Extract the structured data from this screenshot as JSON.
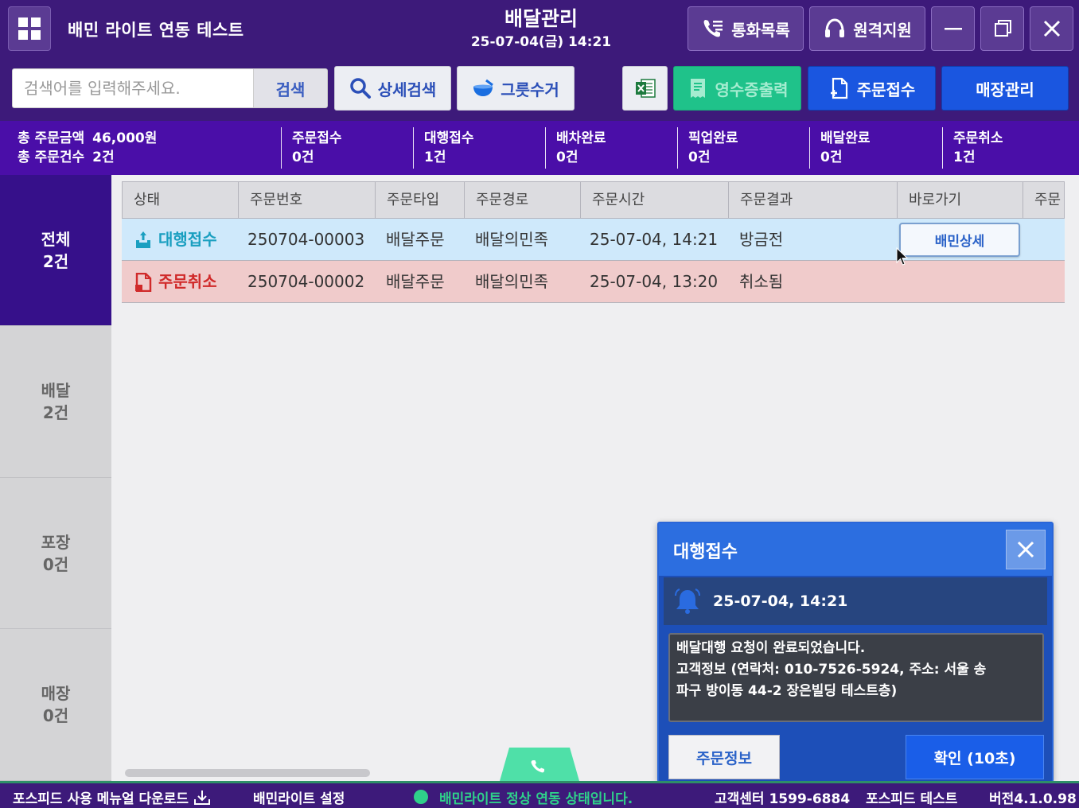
{
  "titlebar": {
    "app_title": "배민 라이트 연동 테스트",
    "page_title": "배달관리",
    "datetime": "25-07-04(금) 14:21",
    "call_log_label": "통화목록",
    "remote_support_label": "원격지원"
  },
  "toolbar": {
    "search_placeholder": "검색어를 입력해주세요.",
    "search_label": "검색",
    "detail_search_label": "상세검색",
    "group_collect_label": "그릇수거",
    "receipt_print_label": "영수증출력",
    "order_receive_label": "주문접수",
    "store_manage_label": "매장관리"
  },
  "stats": {
    "total_amount_label": "총 주문금액",
    "total_amount_value": "46,000원",
    "total_count_label": "총 주문건수",
    "total_count_value": "2건",
    "items": [
      {
        "label": "주문접수",
        "value": "0건"
      },
      {
        "label": "대행접수",
        "value": "1건"
      },
      {
        "label": "배차완료",
        "value": "0건"
      },
      {
        "label": "픽업완료",
        "value": "0건"
      },
      {
        "label": "배달완료",
        "value": "0건"
      },
      {
        "label": "주문취소",
        "value": "1건"
      }
    ]
  },
  "leftnav": [
    {
      "label": "전체",
      "count": "2건"
    },
    {
      "label": "배달",
      "count": "2건"
    },
    {
      "label": "포장",
      "count": "0건"
    },
    {
      "label": "매장",
      "count": "0건"
    }
  ],
  "table": {
    "headers": [
      "상태",
      "주문번호",
      "주문타입",
      "주문경로",
      "주문시간",
      "주문결과",
      "바로가기",
      "주문"
    ],
    "rows": [
      {
        "status": "대행접수",
        "order_no": "250704-00003",
        "type": "배달주문",
        "route": "배달의민족",
        "time": "25-07-04, 14:21",
        "result": "방금전",
        "shortcut": "배민상세"
      },
      {
        "status": "주문취소",
        "order_no": "250704-00002",
        "type": "배달주문",
        "route": "배달의민족",
        "time": "25-07-04, 13:20",
        "result": "취소됨",
        "shortcut": ""
      }
    ]
  },
  "popup": {
    "title": "대행접수",
    "datetime": "25-07-04, 14:21",
    "message_line1": "배달대행 요청이 완료되었습니다.",
    "message_line2": "고객정보 (연락처: 010-7526-5924, 주소: 서울 송",
    "message_line3": "파구 방이동 44-2 장은빌딩 테스트층)",
    "order_info_label": "주문정보",
    "confirm_label": "확인 (10초)"
  },
  "statusbar": {
    "manual_label": "포스피드 사용 메뉴얼 다운로드",
    "settings_label": "배민라이트 설정",
    "status_text": "배민라이트 정상 연동 상태입니다.",
    "support_center": "고객센터 1599-6884",
    "store_name": "포스피드 테스트",
    "version": "버전4.1.0.98"
  },
  "colors": {
    "titlebar_bg": "#3d1a7a",
    "stats_bg": "#4a0ea8",
    "accent_blue": "#1a56e0",
    "accent_green": "#1fc28a",
    "agency_status": "#1a9fc0",
    "cancel_status": "#d02a2a"
  }
}
